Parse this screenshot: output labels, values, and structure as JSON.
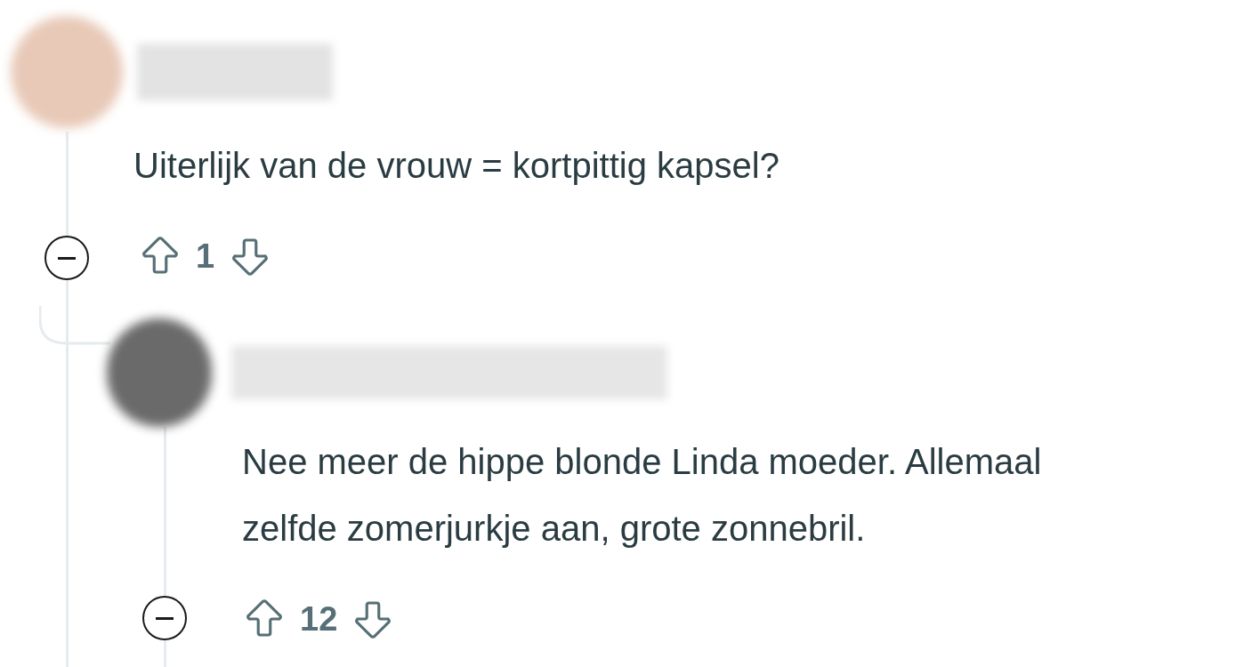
{
  "comments": [
    {
      "body": "Uiterlijk van de vrouw = kortpittig kapsel?",
      "votes": "1",
      "expanded": true,
      "replies": [
        {
          "body": "Nee meer de hippe blonde Linda moeder. Allemaal zelfde zomerjurkje aan, grote zonnebril.",
          "votes": "12",
          "expanded": true
        }
      ]
    }
  ]
}
